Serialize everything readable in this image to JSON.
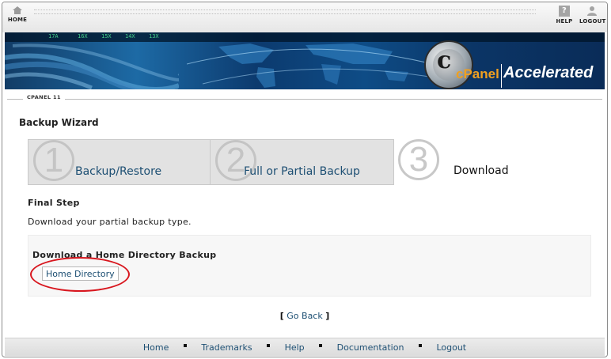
{
  "topnav": {
    "home_label": "HOME",
    "help_label": "HELP",
    "logout_label": "LOGOUT"
  },
  "banner": {
    "ticker": [
      "17A",
      "16X",
      "15X",
      "14X",
      "13X"
    ],
    "logo_letter": "c",
    "brand_cpanel": "cPanel",
    "brand_accel": "Accelerated"
  },
  "version": "CPANEL 11",
  "page_title": "Backup Wizard",
  "steps": [
    {
      "num": "1",
      "label": "Backup/Restore"
    },
    {
      "num": "2",
      "label": "Full or Partial Backup"
    },
    {
      "num": "3",
      "label": "Download"
    }
  ],
  "final_step": "Final Step",
  "description": "Download your partial backup type.",
  "download": {
    "title": "Download a Home Directory Backup",
    "button": "Home Directory"
  },
  "goback": {
    "open": "[",
    "label": "Go Back",
    "close": "]"
  },
  "footer": [
    "Home",
    "Trademarks",
    "Help",
    "Documentation",
    "Logout"
  ],
  "colors": {
    "link": "#1d4f73",
    "highlight_ring": "#d8161e",
    "brand_accent": "#f0a020"
  }
}
